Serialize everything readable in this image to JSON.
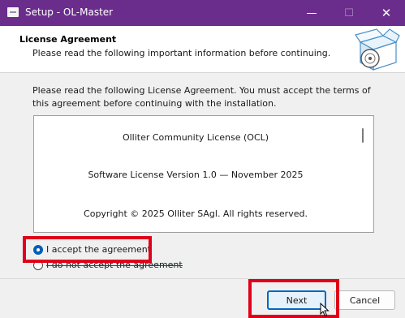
{
  "window": {
    "title": "Setup - OL-Master",
    "minimize_glyph": "—",
    "maximize_glyph": "☐",
    "close_glyph": "✕"
  },
  "header": {
    "title": "License Agreement",
    "subtitle": "Please read the following important information before continuing.",
    "icon": "software-box-icon"
  },
  "intro_text": "Please read the following License Agreement. You must accept the terms of this agreement before continuing with the installation.",
  "license": {
    "lines": [
      "Olliter Community License (OCL)",
      "Software License Version 1.0 — November 2025",
      "Copyright © 2025 Olliter SAgl. All rights reserved."
    ]
  },
  "options": {
    "accept_label": "I accept the agreement",
    "decline_label": "I do not accept the agreement",
    "selected": "accept"
  },
  "buttons": {
    "next": "Next",
    "cancel": "Cancel"
  },
  "colors": {
    "titlebar": "#6b2d8c",
    "highlight": "#e0001a",
    "accent": "#005fb8"
  }
}
